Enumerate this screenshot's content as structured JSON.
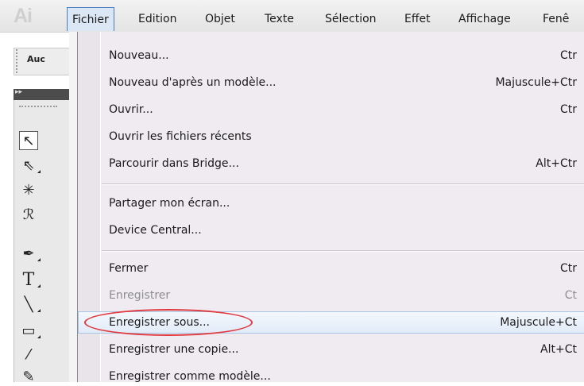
{
  "app": {
    "logo": "Ai"
  },
  "menubar": {
    "items": [
      {
        "label": "Fichier"
      },
      {
        "label": "Edition"
      },
      {
        "label": "Objet"
      },
      {
        "label": "Texte"
      },
      {
        "label": "Sélection"
      },
      {
        "label": "Effet"
      },
      {
        "label": "Affichage"
      },
      {
        "label": "Fenê"
      }
    ]
  },
  "control_bar": {
    "label": "Auc"
  },
  "tools_panel": {
    "header_arrows": "▸▸",
    "tools": [
      {
        "icon": "selection-arrow-icon",
        "glyph": "↖"
      },
      {
        "icon": "direct-selection-icon",
        "glyph": "⇖"
      },
      {
        "icon": "magic-wand-icon",
        "glyph": "✳"
      },
      {
        "icon": "lasso-icon",
        "glyph": "ℛ"
      },
      {
        "icon": "pen-icon",
        "glyph": "✒"
      },
      {
        "icon": "type-icon",
        "glyph": "T"
      },
      {
        "icon": "line-segment-icon",
        "glyph": "╲"
      },
      {
        "icon": "rectangle-icon",
        "glyph": "▭"
      },
      {
        "icon": "paintbrush-icon",
        "glyph": "⁄"
      },
      {
        "icon": "pencil-icon",
        "glyph": "✎"
      }
    ]
  },
  "dropdown": {
    "items": [
      {
        "label": "Nouveau...",
        "shortcut": "Ctr",
        "enabled": true
      },
      {
        "label": "Nouveau d'après un modèle...",
        "shortcut": "Majuscule+Ctr",
        "enabled": true
      },
      {
        "label": "Ouvrir...",
        "shortcut": "Ctr",
        "enabled": true
      },
      {
        "label": "Ouvrir les fichiers récents",
        "shortcut": "",
        "enabled": true
      },
      {
        "label": "Parcourir dans Bridge...",
        "shortcut": "Alt+Ctr",
        "enabled": true
      },
      {
        "label": "Partager mon écran...",
        "shortcut": "",
        "enabled": true
      },
      {
        "label": "Device Central...",
        "shortcut": "",
        "enabled": true
      },
      {
        "label": "Fermer",
        "shortcut": "Ctr",
        "enabled": true
      },
      {
        "label": "Enregistrer",
        "shortcut": "Ct",
        "enabled": false
      },
      {
        "label": "Enregistrer sous...",
        "shortcut": "Majuscule+Ct",
        "enabled": true,
        "highlighted": true
      },
      {
        "label": "Enregistrer une copie...",
        "shortcut": "Alt+Ct",
        "enabled": true
      },
      {
        "label": "Enregistrer comme modèle...",
        "shortcut": "",
        "enabled": true
      }
    ]
  },
  "colors": {
    "menu_background": "#efebf1",
    "highlight": "#e1ebf8",
    "annotation_ellipse": "#e0393e",
    "disabled_text": "#8e8e8e"
  }
}
